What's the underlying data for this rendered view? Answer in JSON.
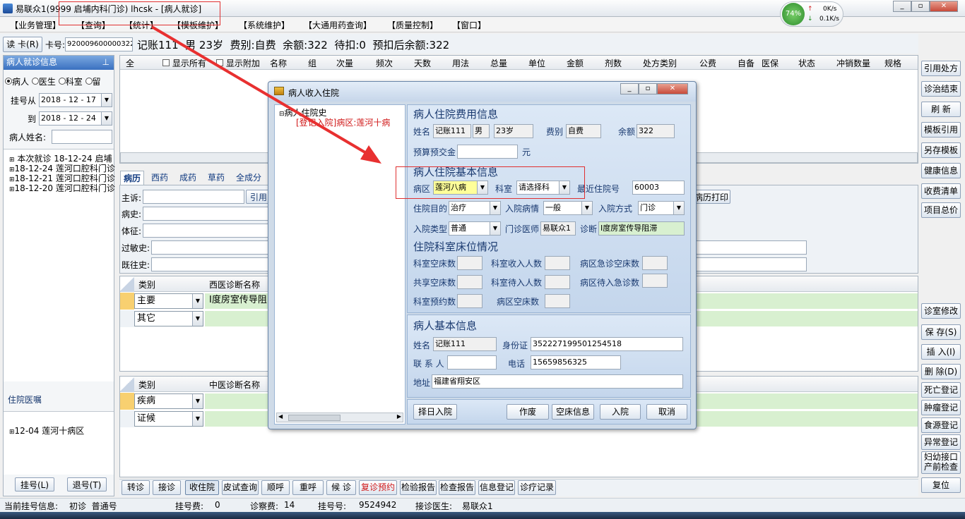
{
  "window": {
    "title": "易联众1(9999 启埔内科门诊) lhcsk - [病人就诊]"
  },
  "network": {
    "percent": "74%",
    "up": "0K/s",
    "down": "0.1K/s"
  },
  "menu": [
    "【业务管理】",
    "【查询】",
    "【统计】",
    "【模板维护】",
    "【系统维护】",
    "【大通用药查询】",
    "【质量控制】",
    "【窗口】"
  ],
  "patient_bar": {
    "read_card": "读 卡(R)",
    "card_label": "卡号:",
    "card_no": "920009600000322",
    "summary": "记账111  男 23岁  费别:自费  余额:322  待扣:0  预扣后余额:322"
  },
  "left_panel": {
    "title": "病人就诊信息",
    "pin": "ᵖ",
    "radios": [
      "病人",
      "医生",
      "科室",
      "留"
    ],
    "from_label": "挂号从",
    "from_date": "2018 - 12 - 17",
    "to_label": "到",
    "to_date": "2018 - 12 - 24",
    "name_label": "病人姓名:",
    "tree": [
      "本次就诊 18-12-24 启埔",
      "18-12-24 莲河口腔科门诊",
      "18-12-21 莲河口腔科门诊",
      "18-12-20 莲河口腔科门诊"
    ],
    "inpatient_title": "住院医嘱",
    "inpatient_tree": [
      "12-04 莲河十病区"
    ],
    "register_btn": "挂号(L)",
    "unregister_btn": "退号(T)"
  },
  "rx_grid": {
    "all": "全",
    "show_all": "显示所有",
    "show_extra": "显示附加",
    "cols": [
      "名称",
      "组",
      "次量",
      "频次",
      "天数",
      "用法",
      "总量",
      "单位",
      "金额",
      "剂数",
      "处方类别",
      "公费",
      "自备",
      "医保",
      "状态",
      "冲销数量",
      "规格"
    ]
  },
  "tabs": [
    "病历",
    "西药",
    "成药",
    "草药",
    "全成分"
  ],
  "record": {
    "fields": [
      "主诉:",
      "病史:",
      "体征:",
      "过敏史:",
      "既往史:"
    ],
    "quote": "引用",
    "print": "病历打印"
  },
  "diag_west": {
    "col1": "类别",
    "col2": "西医诊断名称",
    "rows": [
      {
        "type": "主要",
        "name": "Ⅰ度房室传导阻"
      },
      {
        "type": "其它",
        "name": ""
      }
    ]
  },
  "diag_tcm": {
    "col1": "类别",
    "col2": "中医诊断名称",
    "rows": [
      {
        "type": "疾病"
      },
      {
        "type": "证候"
      }
    ]
  },
  "right_buttons_top": [
    "引用处方",
    "诊治结束",
    "刷 新",
    "模板引用",
    "另存模板",
    "健康信息",
    "收费清单",
    "项目总价"
  ],
  "right_buttons_bottom": [
    "诊室修改",
    "保 存(S)",
    "插 入(I)",
    "删 除(D)",
    "死亡登记",
    "肿瘤登记",
    "食源登记",
    "异常登记",
    "妇幼接口",
    "产前检查",
    "复位"
  ],
  "bottom_buttons": [
    "转诊",
    "接诊",
    "收住院",
    "皮试查询",
    "顺呼",
    "重呼",
    "候 诊",
    "复诊预约",
    "检验报告",
    "检查报告",
    "信息登记",
    "诊疗记录"
  ],
  "status": {
    "visit_label": "当前挂号信息:",
    "visit": "初诊  普通号",
    "fee_label": "挂号费:",
    "fee": "0",
    "exam_label": "诊察费:",
    "exam": "14",
    "reg_label": "挂号号:",
    "reg": "9524942",
    "doctor_label": "接诊医生:",
    "doctor": "易联众1"
  },
  "dialog": {
    "title": "病人收入住院",
    "tree_root": "病人住院史",
    "tree_child": "[登记入院]病区:莲河十病",
    "fee_title": "病人住院费用信息",
    "name_label": "姓名",
    "name": "记账111",
    "sex": "男",
    "age": "23岁",
    "feetype_label": "费别",
    "feetype": "自费",
    "balance_label": "余额",
    "balance": "322",
    "deposit_label": "预算预交金",
    "deposit_unit": "元",
    "basic_title": "病人住院基本信息",
    "ward_label": "病区",
    "ward": "莲河八病",
    "dept_label": "科室",
    "dept": "请选择科",
    "recent_label": "最近住院号",
    "recent": "60003",
    "purpose_label": "住院目的",
    "purpose": "治疗",
    "condition_label": "入院病情",
    "condition": "一般",
    "mode_label": "入院方式",
    "mode": "门诊",
    "admtype_label": "入院类型",
    "admtype": "普通",
    "doctor_label": "门诊医师",
    "doctor": "易联众1",
    "diag_label": "诊断",
    "diag": "Ⅰ度房室传导阻滞",
    "bed_title": "住院科室床位情况",
    "bed_labels": [
      "科室空床数",
      "科室收入人数",
      "病区急诊空床数",
      "共享空床数",
      "科室待入人数",
      "病区待入急诊数",
      "科室预约数",
      "病区空床数"
    ],
    "person_title": "病人基本信息",
    "p_name_label": "姓名",
    "p_name": "记账111",
    "id_label": "身份证",
    "id": "352227199501254518",
    "contact_label": "联 系 人",
    "phone_label": "电话",
    "phone": "15659856325",
    "addr_label": "地址",
    "addr": "福建省翔安区",
    "btn_select_date": "择日入院",
    "btn_void": "作废",
    "btn_bed": "空床信息",
    "btn_admit": "入院",
    "btn_cancel": "取消"
  }
}
